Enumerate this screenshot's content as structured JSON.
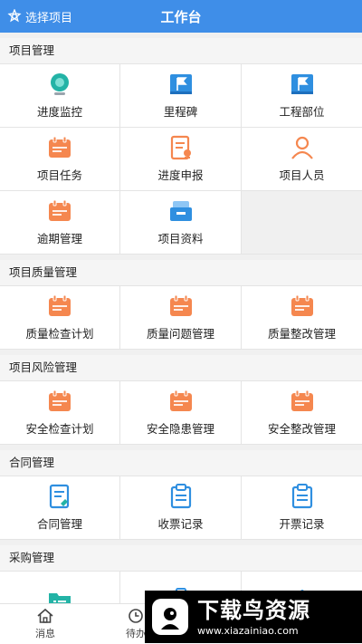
{
  "header": {
    "project_label": "选择项目",
    "title": "工作台"
  },
  "colors": {
    "header_bg": "#3f8ee8",
    "orange": "#f5874f",
    "blue": "#2f8fe0",
    "teal": "#23b3a6"
  },
  "sections": [
    {
      "title": "项目管理",
      "items": [
        {
          "label": "进度监控",
          "icon": "monitor-camera-icon"
        },
        {
          "label": "里程碑",
          "icon": "milestone-flag-icon"
        },
        {
          "label": "工程部位",
          "icon": "flag-icon"
        },
        {
          "label": "项目任务",
          "icon": "calendar-icon"
        },
        {
          "label": "进度申报",
          "icon": "report-form-icon"
        },
        {
          "label": "项目人员",
          "icon": "person-icon"
        },
        {
          "label": "逾期管理",
          "icon": "calendar-icon"
        },
        {
          "label": "项目资料",
          "icon": "tray-icon"
        }
      ]
    },
    {
      "title": "项目质量管理",
      "items": [
        {
          "label": "质量检查计划",
          "icon": "calendar-icon"
        },
        {
          "label": "质量问题管理",
          "icon": "calendar-icon"
        },
        {
          "label": "质量整改管理",
          "icon": "calendar-icon"
        }
      ]
    },
    {
      "title": "项目风险管理",
      "items": [
        {
          "label": "安全检查计划",
          "icon": "calendar-icon"
        },
        {
          "label": "安全隐患管理",
          "icon": "calendar-icon"
        },
        {
          "label": "安全整改管理",
          "icon": "calendar-icon"
        }
      ]
    },
    {
      "title": "合同管理",
      "items": [
        {
          "label": "合同管理",
          "icon": "contract-icon"
        },
        {
          "label": "收票记录",
          "icon": "clipboard-icon"
        },
        {
          "label": "开票记录",
          "icon": "clipboard-icon"
        }
      ]
    },
    {
      "title": "采购管理",
      "items": [
        {
          "label": "",
          "icon": "folder-icon"
        },
        {
          "label": "",
          "icon": "clipboard-check-icon"
        },
        {
          "label": "",
          "icon": "bank-icon"
        }
      ]
    }
  ],
  "tabs": [
    {
      "label": "消息",
      "icon": "home-icon"
    },
    {
      "label": "待办",
      "icon": "clock-icon"
    }
  ],
  "watermark": {
    "title": "下载鸟资源",
    "url": "www.xiazainiao.com"
  }
}
